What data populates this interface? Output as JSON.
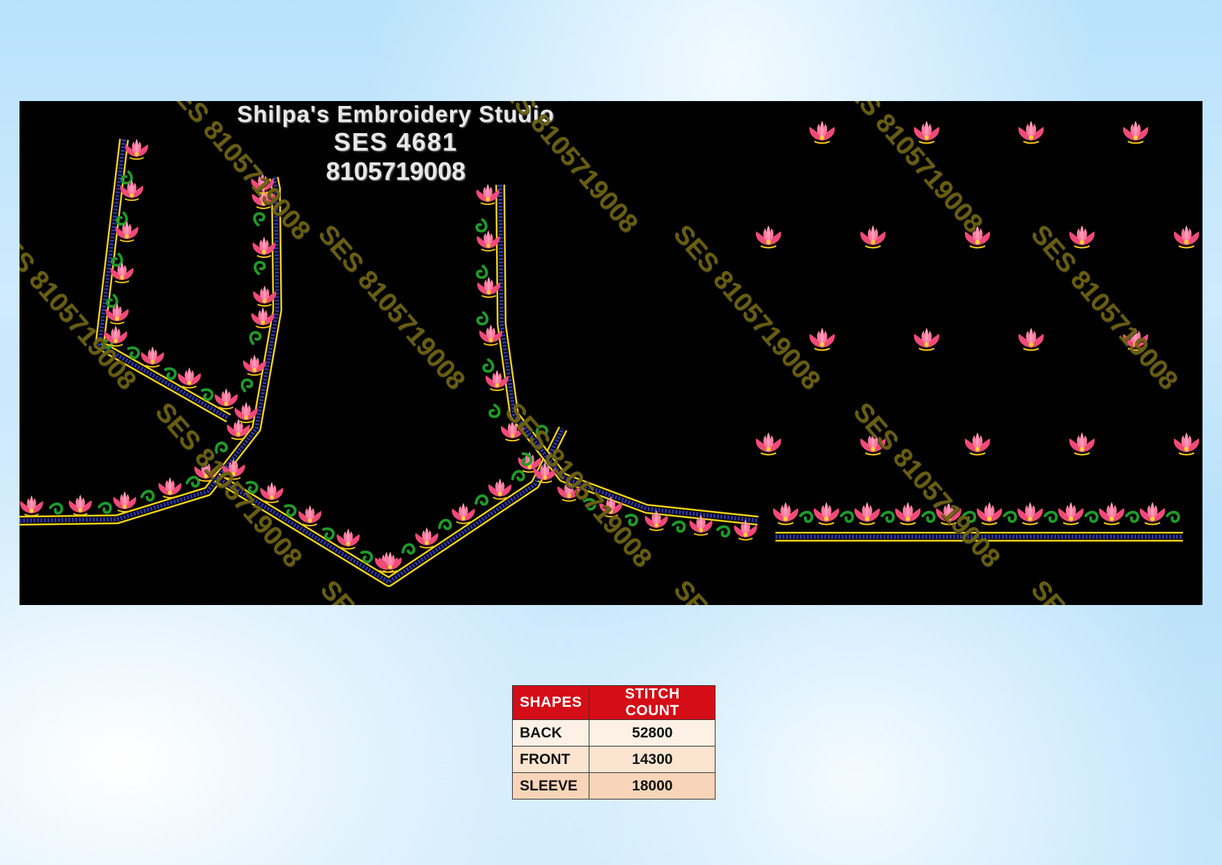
{
  "header": {
    "studio_name": "Shilpa's Embroidery Studio",
    "design_code": "SES 4681",
    "phone": "8105719008"
  },
  "watermark": {
    "text": "SES 8105719008"
  },
  "colors": {
    "panel_background": "#000000",
    "border_gold": "#f2d317",
    "border_blue": "#2c33a8",
    "vine_green": "#1f9a2a",
    "flower_pink": "#f04a78",
    "table_header_red": "#d50d17"
  },
  "stitch_table": {
    "headers": [
      "SHAPES",
      "STITCH COUNT"
    ],
    "rows": [
      {
        "shape": "BACK",
        "count": "52800"
      },
      {
        "shape": "FRONT",
        "count": "14300"
      },
      {
        "shape": "SLEEVE",
        "count": "18000"
      }
    ]
  }
}
